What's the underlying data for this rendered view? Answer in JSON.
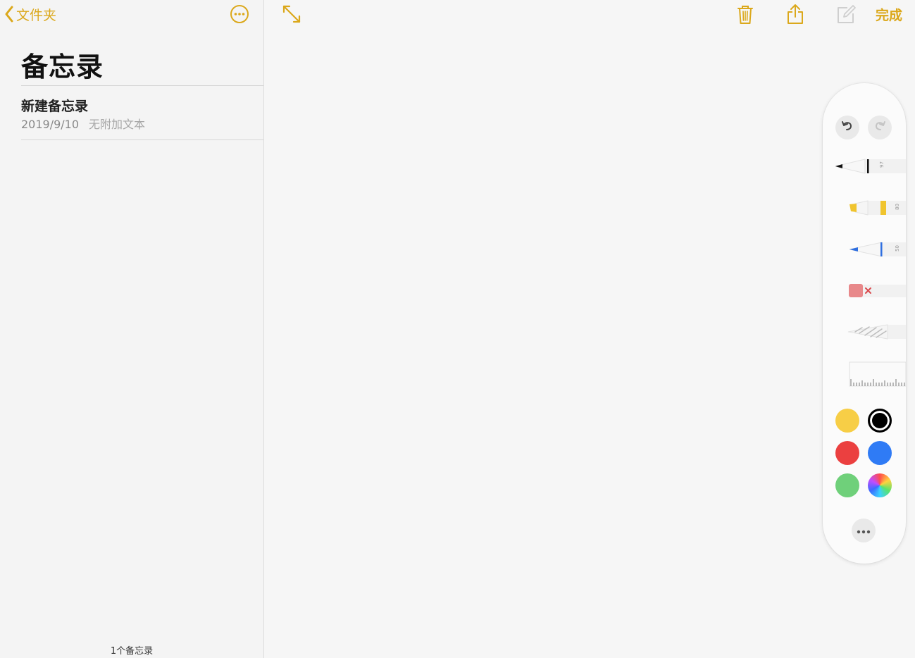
{
  "sidebar": {
    "back_label": "文件夹",
    "title": "备忘录",
    "notes": [
      {
        "title": "新建备忘录",
        "date": "2019/9/10",
        "preview": "无附加文本"
      }
    ],
    "count_label": "1个备忘录"
  },
  "toolbar": {
    "done_label": "完成"
  },
  "palette": {
    "tools": [
      {
        "name": "pen",
        "label": "97",
        "tip_color": "#111111"
      },
      {
        "name": "marker",
        "label": "80",
        "tip_color": "#f0c42e"
      },
      {
        "name": "pencil",
        "label": "50",
        "tip_color": "#2f6fe0"
      },
      {
        "name": "eraser"
      },
      {
        "name": "lasso"
      },
      {
        "name": "ruler"
      }
    ],
    "colors": [
      {
        "name": "yellow",
        "hex": "#f7ce46"
      },
      {
        "name": "black",
        "hex": "#000000",
        "selected": true
      },
      {
        "name": "red",
        "hex": "#eb4040"
      },
      {
        "name": "blue",
        "hex": "#2f7bf5"
      },
      {
        "name": "green",
        "hex": "#6fd07a"
      },
      {
        "name": "multicolor",
        "hex": "conic"
      }
    ]
  },
  "colors": {
    "accent": "#dba81b"
  }
}
